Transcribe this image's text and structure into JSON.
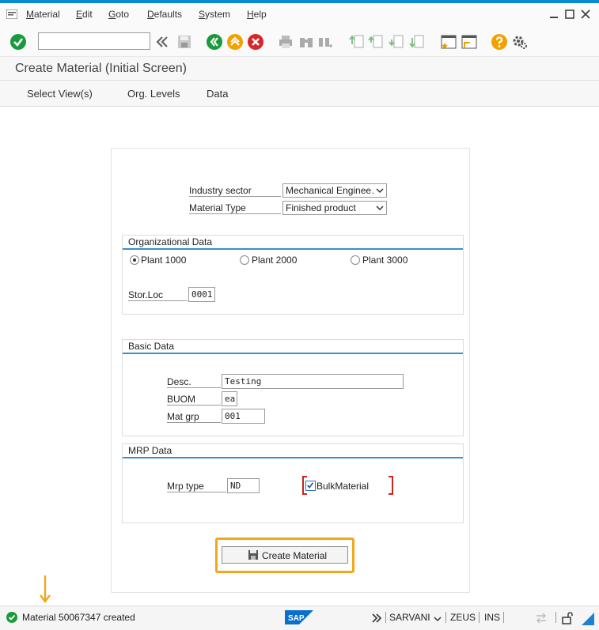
{
  "menu": [
    {
      "key": "M",
      "rest": "aterial"
    },
    {
      "key": "E",
      "rest": "dit"
    },
    {
      "key": "G",
      "rest": "oto"
    },
    {
      "key": "D",
      "rest": "efaults"
    },
    {
      "key": "S",
      "rest": "ystem"
    },
    {
      "key": "H",
      "rest": "elp"
    }
  ],
  "toolbar": {
    "command_field_value": ""
  },
  "title": "Create Material (Initial Screen)",
  "app_toolbar": [
    "Select View(s)",
    "Org. Levels",
    "Data"
  ],
  "form": {
    "industry_sector_label": "Industry sector",
    "industry_sector_value": "Mechanical Enginee…",
    "material_type_label": "Material Type",
    "material_type_value": "Finished product"
  },
  "org_data": {
    "title": "Organizational Data",
    "plants": [
      {
        "label": "Plant 1000",
        "selected": true
      },
      {
        "label": "Plant 2000",
        "selected": false
      },
      {
        "label": "Plant 3000",
        "selected": false
      }
    ],
    "storloc_label": "Stor.Loc",
    "storloc_value": "0001"
  },
  "basic_data": {
    "title": "Basic Data",
    "desc_label": "Desc.",
    "desc_value": "Testing",
    "buom_label": "BUOM",
    "buom_value": "ea",
    "matgrp_label": "Mat grp",
    "matgrp_value": "001"
  },
  "mrp_data": {
    "title": "MRP Data",
    "mrp_type_label": "Mrp type",
    "mrp_type_value": "ND",
    "bulk_label": "BulkMaterial",
    "bulk_checked": true
  },
  "create_button_label": "Create Material",
  "status": {
    "message": "Material 50067347 created",
    "logo": "SAP",
    "user": "SARVANI",
    "system": "ZEUS",
    "mode": "INS"
  },
  "colors": {
    "accent_blue": "#0a8ad0",
    "group_line": "#3a8fcf",
    "highlight_orange": "#f4a71d",
    "ok_green": "#1a9a3a"
  }
}
